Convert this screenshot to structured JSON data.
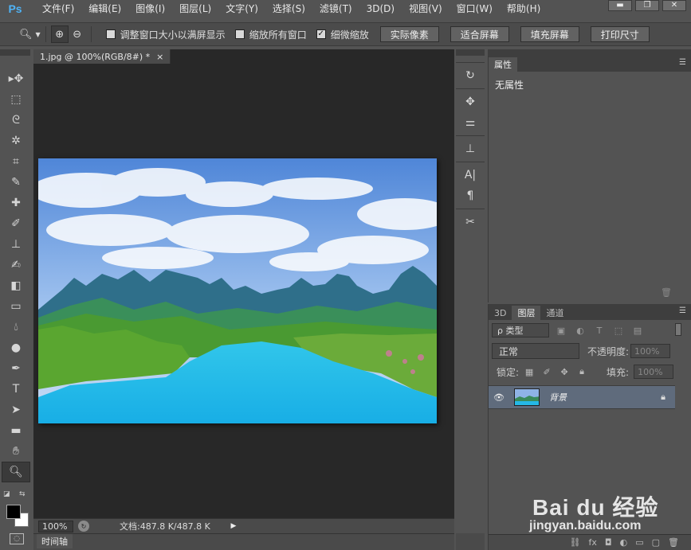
{
  "app": {
    "logo": "Ps"
  },
  "menu": [
    "文件(F)",
    "编辑(E)",
    "图像(I)",
    "图层(L)",
    "文字(Y)",
    "选择(S)",
    "滤镜(T)",
    "3D(D)",
    "视图(V)",
    "窗口(W)",
    "帮助(H)"
  ],
  "window_controls": [
    "▬",
    "❐",
    "✕"
  ],
  "options": {
    "checks": [
      {
        "label": "调整窗口大小以满屏显示",
        "checked": false
      },
      {
        "label": "缩放所有窗口",
        "checked": false
      },
      {
        "label": "细微缩放",
        "checked": true
      }
    ],
    "buttons": [
      "实际像素",
      "适合屏幕",
      "填充屏幕",
      "打印尺寸"
    ]
  },
  "document": {
    "tab_label": "1.jpg @ 100%(RGB/8#) *",
    "tab_close": "×",
    "zoom": "100%",
    "doc_info": "文档:487.8 K/487.8 K"
  },
  "timeline_tab": "时间轴",
  "properties_panel": {
    "tab": "属性",
    "empty_text": "无属性"
  },
  "layers_panel": {
    "tabs": [
      "3D",
      "图层",
      "通道"
    ],
    "active_tab": 1,
    "filter_label": "ρ 类型",
    "blend_mode": "正常",
    "opacity_label": "不透明度:",
    "opacity_value": "100%",
    "lock_label": "锁定:",
    "fill_label": "填充:",
    "fill_value": "100%",
    "layers": [
      {
        "name": "背景",
        "visible": true,
        "locked": true
      }
    ]
  },
  "watermark": {
    "name": "Bai du 经验",
    "url": "jingyan.baidu.com"
  }
}
